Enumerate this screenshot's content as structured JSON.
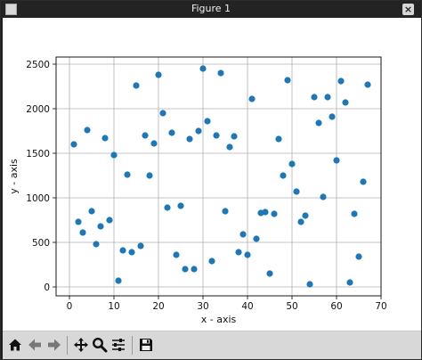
{
  "window": {
    "title": "Figure 1"
  },
  "toolbar": {
    "icons": [
      "home-icon",
      "back-arrow-icon",
      "forward-arrow-icon",
      "pan-icon",
      "zoom-icon",
      "configure-subplots-icon",
      "save-icon"
    ]
  },
  "colors": {
    "marker": "#1f77b4",
    "grid": "#b0b0b0",
    "axes": "#000000",
    "toolbar_bg": "#d8d8d8",
    "titlebar_bg": "#232323"
  },
  "chart_data": {
    "type": "scatter",
    "title": "",
    "xlabel": "x - axis",
    "ylabel": "y - axis",
    "xlim": [
      -3,
      70
    ],
    "ylim": [
      -100,
      2580
    ],
    "xticks": [
      0,
      10,
      20,
      30,
      40,
      50,
      60,
      70
    ],
    "yticks": [
      0,
      500,
      1000,
      1500,
      2000,
      2500
    ],
    "grid": true,
    "x": [
      1,
      2,
      3,
      4,
      5,
      6,
      7,
      8,
      9,
      10,
      11,
      12,
      13,
      14,
      15,
      16,
      17,
      18,
      19,
      20,
      21,
      22,
      23,
      24,
      25,
      26,
      27,
      28,
      29,
      30,
      31,
      32,
      33,
      34,
      35,
      36,
      37,
      38,
      39,
      40,
      41,
      42,
      43,
      44,
      45,
      46,
      47,
      48,
      49,
      50,
      51,
      52,
      53,
      54,
      55,
      56,
      57,
      58,
      59,
      60,
      61,
      62,
      63,
      64,
      65,
      66,
      67
    ],
    "y": [
      1600,
      730,
      610,
      1760,
      850,
      480,
      680,
      1670,
      750,
      1480,
      70,
      410,
      1260,
      390,
      2260,
      460,
      1700,
      1250,
      1610,
      2380,
      1950,
      890,
      1730,
      360,
      910,
      200,
      1660,
      200,
      1750,
      2450,
      1860,
      290,
      1700,
      2400,
      850,
      1570,
      1690,
      390,
      590,
      360,
      2110,
      540,
      830,
      840,
      150,
      820,
      1660,
      1250,
      2320,
      1380,
      1070,
      730,
      800,
      30,
      2130,
      1840,
      1010,
      2130,
      1910,
      1420,
      2310,
      2070,
      50,
      820,
      340,
      1180,
      2270
    ]
  }
}
